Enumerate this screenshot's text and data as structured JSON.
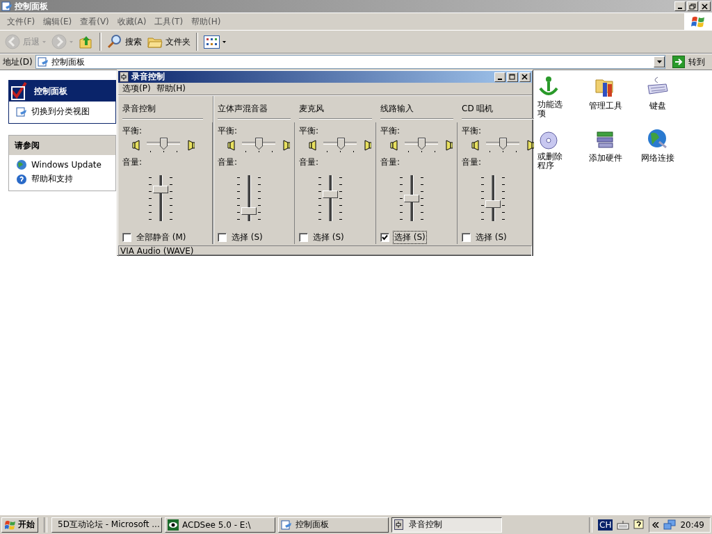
{
  "window": {
    "title": "控制面板",
    "menu": [
      "文件(F)",
      "编辑(E)",
      "查看(V)",
      "收藏(A)",
      "工具(T)",
      "帮助(H)"
    ]
  },
  "toolbar": {
    "items": [
      {
        "kind": "back",
        "label": "后退",
        "disabled": true
      },
      {
        "kind": "forward",
        "disabled": true
      },
      {
        "kind": "up",
        "disabled": false
      },
      {
        "kind": "search",
        "label": "搜索",
        "disabled": false
      },
      {
        "kind": "folders",
        "label": "文件夹",
        "disabled": false
      },
      {
        "kind": "views",
        "disabled": false
      }
    ]
  },
  "address": {
    "label": "地址(D)",
    "value": "控制面板",
    "go": "转到"
  },
  "sidebar": {
    "panels": [
      {
        "kind": "main",
        "title": "控制面板",
        "items": [
          "切换到分类视图"
        ]
      },
      {
        "kind": "see_also",
        "title": "请参阅",
        "items": [
          "Windows Update",
          "帮助和支持"
        ]
      }
    ]
  },
  "icons": [
    {
      "kind": "accessibility",
      "label": "功能选项"
    },
    {
      "kind": "admin",
      "label": "管理工具"
    },
    {
      "kind": "keyboard",
      "label": "键盘"
    },
    {
      "kind": "addremove",
      "label": "或删除程序"
    },
    {
      "kind": "hardware",
      "label": "添加硬件"
    },
    {
      "kind": "network",
      "label": "网络连接"
    }
  ],
  "dialog": {
    "title": "录音控制",
    "menu": [
      "选项(P)",
      "帮助(H)"
    ],
    "channels": [
      {
        "name": "录音控制",
        "balance_label": "平衡:",
        "volume_label": "音量:",
        "balance": {
          "level": 0.5
        },
        "volume": {
          "level": 0.72
        },
        "option": "全部静音 (M)",
        "checked": false,
        "focused": false
      },
      {
        "name": "立体声混音器",
        "balance_label": "平衡:",
        "volume_label": "音量:",
        "balance": {
          "level": 0.5
        },
        "volume": {
          "level": 0.18
        },
        "option": "选择 (S)",
        "checked": false,
        "focused": false
      },
      {
        "name": "麦克风",
        "balance_label": "平衡:",
        "volume_label": "音量:",
        "balance": {
          "level": 0.55
        },
        "volume": {
          "level": 0.6
        },
        "option": "选择 (S)",
        "checked": false,
        "focused": false
      },
      {
        "name": "线路输入",
        "balance_label": "平衡:",
        "volume_label": "音量:",
        "balance": {
          "level": 0.5
        },
        "volume": {
          "level": 0.5
        },
        "option": "选择 (S)",
        "checked": true,
        "focused": true
      },
      {
        "name": "CD 唱机",
        "balance_label": "平衡:",
        "volume_label": "音量:",
        "balance": {
          "level": 0.5
        },
        "volume": {
          "level": 0.35
        },
        "option": "选择 (S)",
        "checked": false,
        "focused": false
      }
    ],
    "status": "VIA Audio (WAVE)"
  },
  "taskbar": {
    "start": "开始",
    "tasks": [
      {
        "kind": "ie",
        "label": "5D互动论坛 - Microsoft ...",
        "selected": false
      },
      {
        "kind": "acdsee",
        "label": "ACDSee 5.0 - E:\\",
        "selected": false
      },
      {
        "kind": "folder",
        "label": "控制面板",
        "selected": false
      },
      {
        "kind": "mixer",
        "label": "录音控制",
        "selected": true
      }
    ],
    "language": "CH",
    "clock": "20:49"
  }
}
